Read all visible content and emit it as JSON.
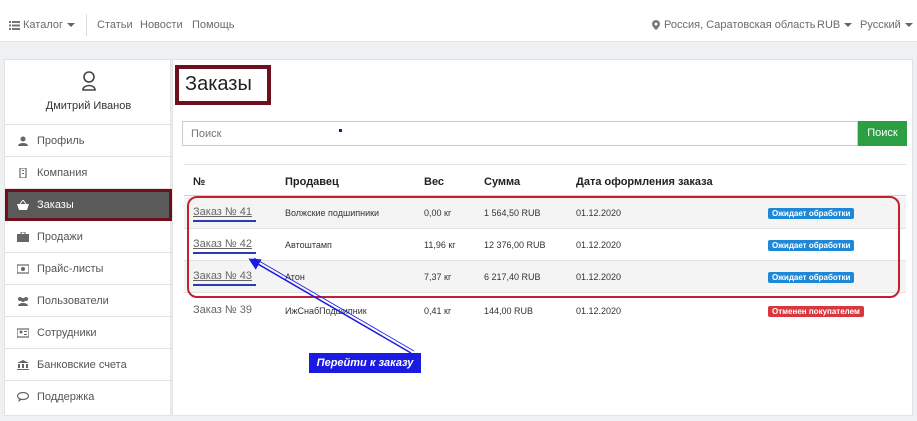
{
  "topbar": {
    "catalog": "Каталог",
    "articles": "Статьи",
    "news": "Новости",
    "help": "Помощь",
    "location": "Россия, Саратовская область",
    "currency": "RUB",
    "language": "Русский"
  },
  "sidebar": {
    "user_name": "Дмитрий Иванов",
    "items": [
      {
        "label": "Профиль",
        "icon": "user-icon"
      },
      {
        "label": "Компания",
        "icon": "building-icon"
      },
      {
        "label": "Заказы",
        "icon": "basket-icon"
      },
      {
        "label": "Продажи",
        "icon": "briefcase-icon"
      },
      {
        "label": "Прайс-листы",
        "icon": "money-icon"
      },
      {
        "label": "Пользователи",
        "icon": "users-icon"
      },
      {
        "label": "Сотрудники",
        "icon": "id-card-icon"
      },
      {
        "label": "Банковские счета",
        "icon": "bank-icon"
      },
      {
        "label": "Поддержка",
        "icon": "chat-icon"
      }
    ],
    "active_index": 2
  },
  "main": {
    "title": "Заказы",
    "search_placeholder": "Поиск",
    "search_button": "Поиск",
    "columns": [
      "№",
      "Продавец",
      "Вес",
      "Сумма",
      "Дата оформления заказа"
    ],
    "rows": [
      {
        "number": "Заказ № 41",
        "seller": "Волжские подшипники",
        "weight": "0,00 кг",
        "sum": "1 564,50 RUB",
        "date": "01.12.2020",
        "status": "Ожидает обработки",
        "status_color": "#1e88d8"
      },
      {
        "number": "Заказ № 42",
        "seller": "Автоштамп",
        "weight": "11,96 кг",
        "sum": "12 376,00 RUB",
        "date": "01.12.2020",
        "status": "Ожидает обработки",
        "status_color": "#1e88d8"
      },
      {
        "number": "Заказ № 43",
        "seller": "Атон",
        "weight": "7,37 кг",
        "sum": "6 217,40 RUB",
        "date": "01.12.2020",
        "status": "Ожидает обработки",
        "status_color": "#1e88d8"
      },
      {
        "number": "Заказ № 39",
        "seller": "ИжСнабПодшипник",
        "weight": "0,41 кг",
        "sum": "144,00 RUB",
        "date": "01.12.2020",
        "status": "Отменен покупателем",
        "status_color": "#d9363e"
      }
    ]
  },
  "annotation": {
    "label": "Перейти к заказу"
  },
  "colors": {
    "accent_green": "#2c9e44",
    "highlight_maroon": "#6e0f1e",
    "highlight_red": "#c61f34",
    "annotation_blue": "#1a1ae0"
  }
}
